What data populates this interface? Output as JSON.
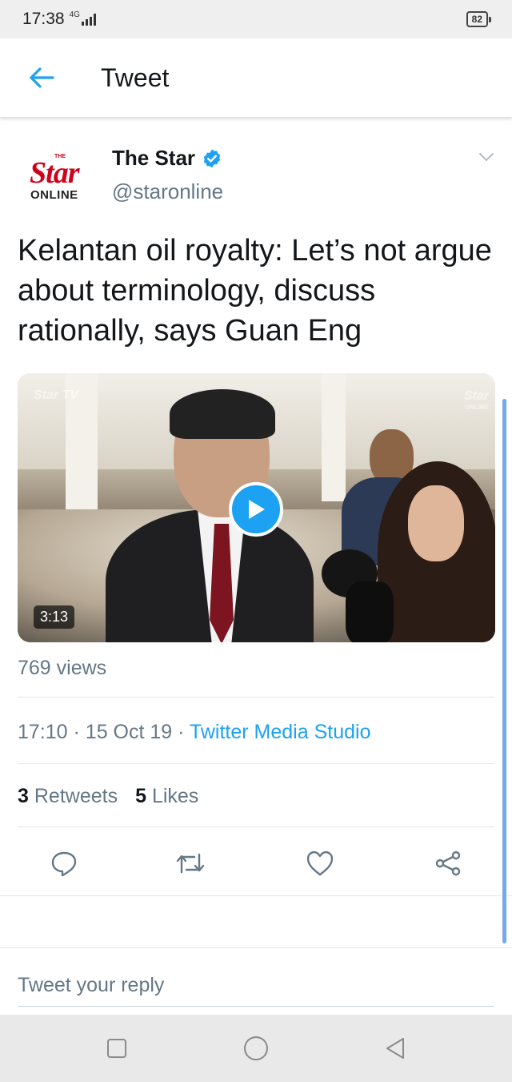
{
  "status_bar": {
    "time": "17:38",
    "network": "4G",
    "battery": "82"
  },
  "header": {
    "title": "Tweet"
  },
  "tweet": {
    "author": {
      "name": "The Star",
      "handle": "@staronline",
      "logo_the": "THE",
      "logo_star": "Star",
      "logo_online": "ONLINE"
    },
    "text": "Kelantan oil royalty: Let’s not argue about terminology, discuss rationally, says Guan Eng",
    "media": {
      "duration": "3:13",
      "watermark_left": "Star TV",
      "watermark_right": "Star",
      "watermark_right_sub": "ONLINE"
    },
    "views": "769 views",
    "time": "17:10",
    "date": "15 Oct 19",
    "source": "Twitter Media Studio",
    "retweets": {
      "count": "3",
      "label": "Retweets"
    },
    "likes": {
      "count": "5",
      "label": "Likes"
    }
  },
  "reply": {
    "placeholder": "Tweet your reply"
  },
  "colors": {
    "accent": "#1da1f2",
    "secondary_text": "#657786",
    "brand_red": "#d0021b"
  },
  "icons": [
    "back-arrow-icon",
    "verified-badge-icon",
    "chevron-down-icon",
    "play-icon",
    "reply-icon",
    "retweet-icon",
    "like-icon",
    "share-icon",
    "nav-recents-icon",
    "nav-home-icon",
    "nav-back-icon"
  ]
}
